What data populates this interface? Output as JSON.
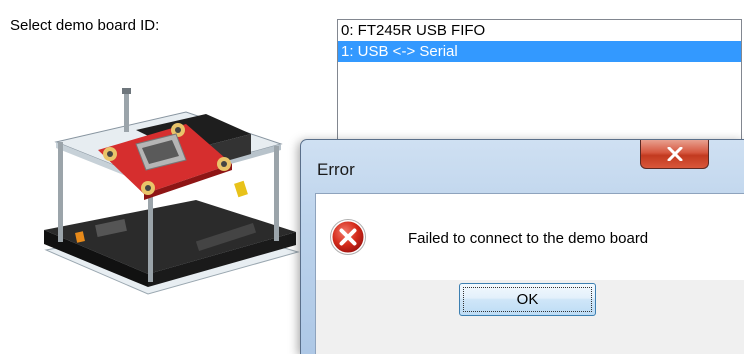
{
  "label": "Select demo board ID:",
  "board_list": {
    "items": [
      {
        "label": "0: FT245R USB FIFO",
        "selected": false
      },
      {
        "label": "1: USB <-> Serial",
        "selected": true
      }
    ]
  },
  "board_image": {
    "icon": "demo-board-image"
  },
  "dialog": {
    "title": "Error",
    "close_glyph": "X",
    "message": "Failed to connect to the demo board",
    "ok_label": "OK",
    "icon": "error-icon"
  },
  "colors": {
    "selection": "#3399ff",
    "close_button": "#c94a30",
    "error_icon": "#c41e1e"
  }
}
